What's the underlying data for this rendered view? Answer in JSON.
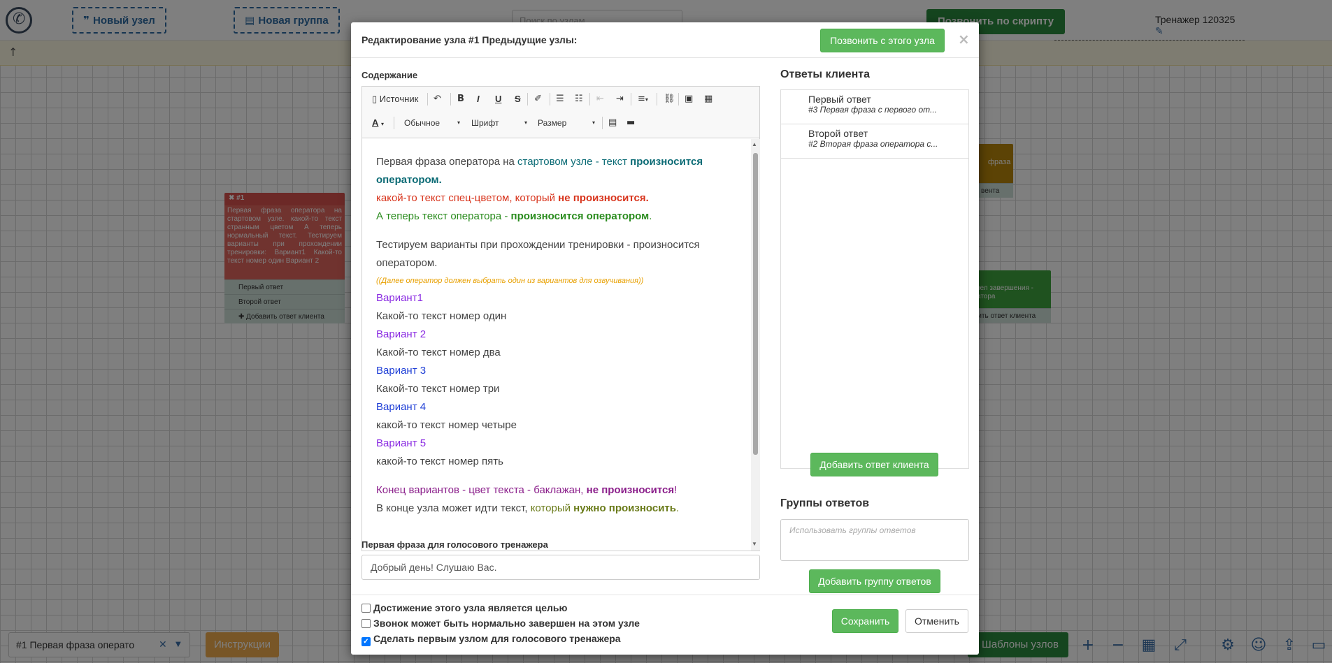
{
  "toolbar": {
    "new_node": "Новый узел",
    "new_group": "Новая группа",
    "search_placeholder": "Поиск по узлам",
    "call_by_script": "Позвонить по скрипту",
    "trainer_name": "Тренажер 120325"
  },
  "canvas": {
    "node1": {
      "id": "#1",
      "body": "Первая фраза оператора на стартовом узле. какой-то текст странным цветом А теперь нормальный текст. Тестируем варианты при прохождении тренировки: Вариант1 Какой-то текст номер один Вариант 2",
      "answers": [
        "Первый ответ",
        "Второй ответ"
      ],
      "add_answer": "Добавить ответ клиента"
    },
    "node_orange": {
      "label": "фраза",
      "sub": "вента"
    },
    "node_green": {
      "label": "зел завершения - атора",
      "add": "вить ответ клиента"
    }
  },
  "bottom": {
    "node_select": "#1 Первая фраза операто",
    "instructions": "Инструкции",
    "templates": "Шаблоны узлов"
  },
  "modal": {
    "title": "Редактирование узла #1 Предыдущие узлы:",
    "call_from_node": "Позвонить с этого узла",
    "content_label": "Содержание",
    "editor_toolbar": {
      "source": "Источник",
      "format": "Обычное",
      "font": "Шрифт",
      "size": "Размер"
    },
    "content": {
      "l1a": "Первая фраза оператора на ",
      "l1b": "стартовом узле - текст ",
      "l1c": "произносится",
      "l2": "оператором.",
      "l3a": "какой-то текст спец-цветом, который ",
      "l3b": "не произносится.",
      "l4a": "А теперь текст оператора - ",
      "l4b": "произносится оператором",
      "l4c": ".",
      "l5": "Тестируем варианты при прохождении тренировки - произносится",
      "l6": "оператором.",
      "l7": "((Далее оператор должен выбрать один из вариантов для озвучивания))",
      "v1": "Вариант1",
      "t1": "Какой-то текст номер один",
      "v2": "Вариант 2",
      "t2": "Какой-то текст номер два",
      "v3": "Вариант 3",
      "t3": "Какой-то текст номер три",
      "v4": "Вариант 4",
      "t4": "какой-то текст номер четыре",
      "v5": "Вариант 5",
      "t5": "какой-то текст номер пять",
      "e1a": "Конец вариантов - цвет текста - баклажан, ",
      "e1b": "не произносится",
      "e1c": "!",
      "e2a": "В конце узла может идти текст, ",
      "e2b": "который ",
      "e2c": "нужно произносить",
      "e2d": "."
    },
    "voice_label": "Первая фраза для голосового тренажера",
    "voice_value": "Добрый день! Слушаю Вас.",
    "answers_label": "Ответы клиента",
    "answers": [
      {
        "title": "Первый ответ",
        "sub": "#3 Первая фраза с первого от..."
      },
      {
        "title": "Второй ответ",
        "sub": "#2 Вторая фраза оператора с..."
      }
    ],
    "add_answer": "Добавить ответ клиента",
    "groups_label": "Группы ответов",
    "groups_placeholder": "Использовать группы ответов",
    "add_group": "Добавить группу ответов",
    "checkboxes": [
      {
        "label": "Достижение этого узла является целью",
        "checked": false
      },
      {
        "label": "Звонок может быть нормально завершен на этом узле",
        "checked": false
      },
      {
        "label": "Сделать первым узлом для голосового тренажера",
        "checked": true
      }
    ],
    "save": "Сохранить",
    "cancel": "Отменить"
  },
  "colors": {
    "primary_green": "#5cb85c",
    "dark_green": "#2b8a3e",
    "node_red": "#d9534f",
    "orange": "#f0ad4e",
    "link_blue": "#2d6aa3"
  }
}
